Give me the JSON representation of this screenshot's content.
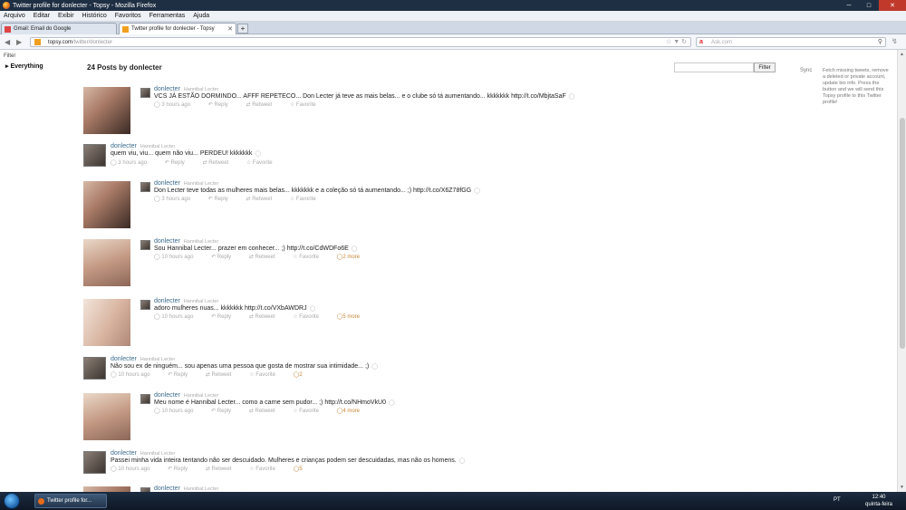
{
  "window": {
    "title": "Twitter profile for donlecter - Topsy - Mozilla Firefox"
  },
  "menu": [
    "Arquivo",
    "Editar",
    "Exibir",
    "Histórico",
    "Favoritos",
    "Ferramentas",
    "Ajuda"
  ],
  "tabs": [
    {
      "label": "Gmail: Email do Google"
    },
    {
      "label": "Twitter profile for donlecter - Topsy"
    }
  ],
  "address": {
    "host": "topsy.com",
    "path": "/twitter/donlecter"
  },
  "search": {
    "placeholder": "Ask.com"
  },
  "page": {
    "filter_label": "Filter",
    "everything": "Everything",
    "heading": "24 Posts by donlecter",
    "filter_button": "Filter",
    "sync_label": "Sync",
    "sync_text": "Fetch missing tweets, remove a deleted or private account, update bio info. Press the button and we will send this Topsy profile to this Twitter profile!"
  },
  "posts": [
    {
      "user": "donlecter",
      "realname": "Hannibal Lecter",
      "text": "VCS JÁ ESTÃO DORMINDO... AFFF REPETECO... Don Lecter já teve as mais belas... e o clube só tá aumentando... kkkkkkk http://t.co/MbjtaSaF",
      "time": "3 hours ago",
      "reply": "Reply",
      "retweet": "Retweet",
      "favorite": "Favorite",
      "more": ""
    },
    {
      "user": "donlecter",
      "realname": "Hannibal Lecter",
      "text": "quem viu, viu... quem não viu... PERDEU! kkkkkkk",
      "time": "3 hours ago",
      "reply": "Reply",
      "retweet": "Retweet",
      "favorite": "Favorite",
      "more": ""
    },
    {
      "user": "donlecter",
      "realname": "Hannibal Lecter",
      "text": "Don Lecter teve todas as mulheres mais belas... kkkkkkk e a coleção só tá aumentando... ;) http://t.co/X6Z78fGG",
      "time": "3 hours ago",
      "reply": "Reply",
      "retweet": "Retweet",
      "favorite": "Favorite",
      "more": ""
    },
    {
      "user": "donlecter",
      "realname": "Hannibal Lecter",
      "text": "Sou Hannibal Lecter... prazer em conhecer... ;) http://t.co/CdWDFo6E",
      "time": "10 hours ago",
      "reply": "Reply",
      "retweet": "Retweet",
      "favorite": "Favorite",
      "more": "2 more"
    },
    {
      "user": "donlecter",
      "realname": "Hannibal Lecter",
      "text": "adoro mulheres nuas... kkkkkkk http://t.co/VXbAWDRJ",
      "time": "10 hours ago",
      "reply": "Reply",
      "retweet": "Retweet",
      "favorite": "Favorite",
      "more": "5 more"
    },
    {
      "user": "donlecter",
      "realname": "Hannibal Lecter",
      "text": "Não sou ex de ninguém... sou apenas uma pessoa que gosta de mostrar sua intimidade... ;)",
      "time": "10 hours ago",
      "reply": "Reply",
      "retweet": "Retweet",
      "favorite": "Favorite",
      "more": "2"
    },
    {
      "user": "donlecter",
      "realname": "Hannibal Lecter",
      "text": "Meu nome é Hannibal Lecter... como a carne sem pudor... ;) http://t.co/NHmoVkU0",
      "time": "10 hours ago",
      "reply": "Reply",
      "retweet": "Retweet",
      "favorite": "Favorite",
      "more": "4 more"
    },
    {
      "user": "donlecter",
      "realname": "Hannibal Lecter",
      "text": "Passei minha vida inteira tentando não ser descuidado. Mulheres e crianças podem ser descuidadas, mas não os homens.",
      "time": "10 hours ago",
      "reply": "Reply",
      "retweet": "Retweet",
      "favorite": "Favorite",
      "more": "5"
    },
    {
      "user": "donlecter",
      "realname": "Hannibal Lecter",
      "text": "",
      "time": "",
      "reply": "",
      "retweet": "",
      "favorite": "",
      "more": ""
    }
  ],
  "taskbar": {
    "task_label": "Twitter profile for...",
    "lang": "PT",
    "time": "12:40",
    "day": "quinta-feira"
  }
}
